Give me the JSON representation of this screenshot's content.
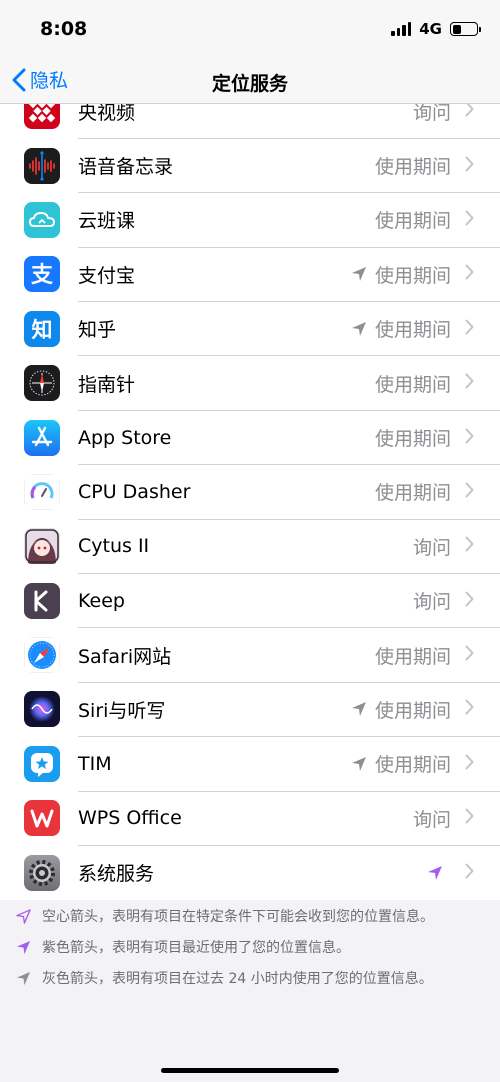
{
  "status_bar": {
    "time": "8:08",
    "network": "4G",
    "battery_percent": 35
  },
  "nav": {
    "back_label": "隐私",
    "title": "定位服务"
  },
  "apps": [
    {
      "name": "央视频",
      "status": "询问",
      "arrow": "none",
      "icon": "cctv-video-icon",
      "color": "#d0021b"
    },
    {
      "name": "语音备忘录",
      "status": "使用期间",
      "arrow": "none",
      "icon": "voice-memos-icon",
      "color": "#1c1c1e"
    },
    {
      "name": "云班课",
      "status": "使用期间",
      "arrow": "none",
      "icon": "cloud-class-icon",
      "color": "#2ec4d6"
    },
    {
      "name": "支付宝",
      "status": "使用期间",
      "arrow": "gray",
      "icon": "alipay-icon",
      "color": "#1677ff"
    },
    {
      "name": "知乎",
      "status": "使用期间",
      "arrow": "gray",
      "icon": "zhihu-icon",
      "color": "#0f88eb"
    },
    {
      "name": "指南针",
      "status": "使用期间",
      "arrow": "none",
      "icon": "compass-icon",
      "color": "#1c1c1e"
    },
    {
      "name": "App Store",
      "status": "使用期间",
      "arrow": "none",
      "icon": "app-store-icon",
      "color": "#1a8cff"
    },
    {
      "name": "CPU Dasher",
      "status": "使用期间",
      "arrow": "none",
      "icon": "cpu-dasher-icon",
      "color": "#ffffff"
    },
    {
      "name": "Cytus II",
      "status": "询问",
      "arrow": "none",
      "icon": "cytus-icon",
      "color": "#d8c8d8"
    },
    {
      "name": "Keep",
      "status": "询问",
      "arrow": "none",
      "icon": "keep-icon",
      "color": "#4a4050"
    },
    {
      "name": "Safari网站",
      "status": "使用期间",
      "arrow": "none",
      "icon": "safari-icon",
      "color": "#1a8cff"
    },
    {
      "name": "Siri与听写",
      "status": "使用期间",
      "arrow": "gray",
      "icon": "siri-icon",
      "color": "#101030"
    },
    {
      "name": "TIM",
      "status": "使用期间",
      "arrow": "gray",
      "icon": "tim-icon",
      "color": "#1a9cf0"
    },
    {
      "name": "WPS Office",
      "status": "询问",
      "arrow": "none",
      "icon": "wps-icon",
      "color": "#e8343a"
    },
    {
      "name": "系统服务",
      "status": "",
      "arrow": "purple",
      "icon": "settings-gear-icon",
      "color": "#8e8e93"
    }
  ],
  "notes": [
    {
      "icon": "hollow-arrow-icon",
      "text": "空心箭头，表明有项目在特定条件下可能会收到您的位置信息。"
    },
    {
      "icon": "purple-arrow-icon",
      "text": "紫色箭头，表明有项目最近使用了您的位置信息。"
    },
    {
      "icon": "gray-arrow-icon",
      "text": "灰色箭头，表明有项目在过去 24 小时内使用了您的位置信息。"
    }
  ],
  "colors": {
    "accent": "#007aff",
    "purple_arrow": "#a65cf0",
    "gray_arrow": "#8e8e93"
  }
}
